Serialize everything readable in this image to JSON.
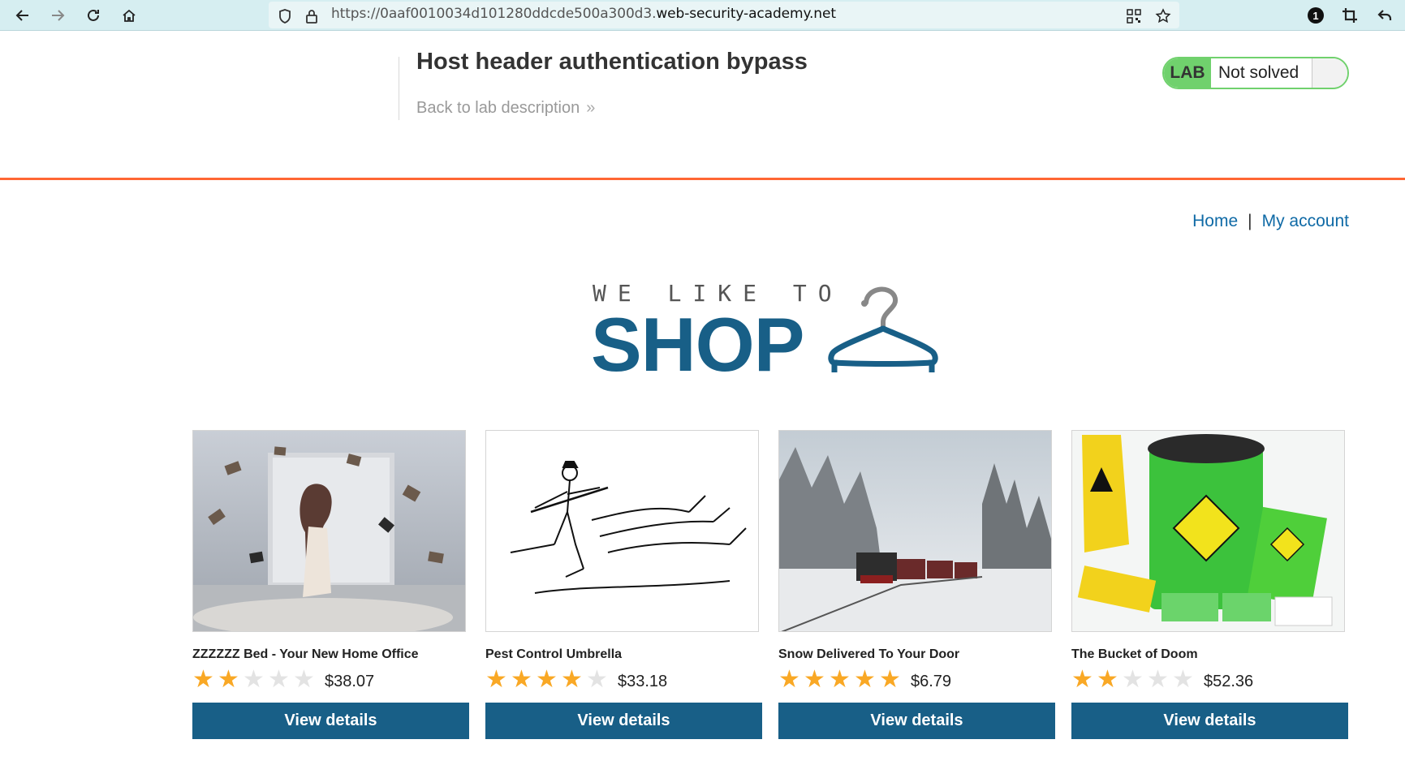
{
  "browser": {
    "url_prefix": "https://0aaf0010034d101280ddcde500a300d3.",
    "url_domain": "web-security-academy.net",
    "notification_count": "1"
  },
  "lab": {
    "title": "Host header authentication bypass",
    "back_link": "Back to lab description",
    "badge": "LAB",
    "status": "Not solved",
    "status_color": "#70d16d"
  },
  "nav": {
    "home": "Home",
    "separator": "|",
    "account": "My account"
  },
  "logo": {
    "small": "WE LIKE TO",
    "big": "SHOP"
  },
  "products": [
    {
      "name": "ZZZZZZ Bed - Your New Home Office",
      "rating": 2,
      "price": "$38.07",
      "button": "View details"
    },
    {
      "name": "Pest Control Umbrella",
      "rating": 4,
      "price": "$33.18",
      "button": "View details"
    },
    {
      "name": "Snow Delivered To Your Door",
      "rating": 5,
      "price": "$6.79",
      "button": "View details"
    },
    {
      "name": "The Bucket of Doom",
      "rating": 2,
      "price": "$52.36",
      "button": "View details"
    }
  ],
  "colors": {
    "brand": "#185f87",
    "accent_line": "#ff6633",
    "link": "#0f6aa6",
    "star": "#f9a825"
  }
}
